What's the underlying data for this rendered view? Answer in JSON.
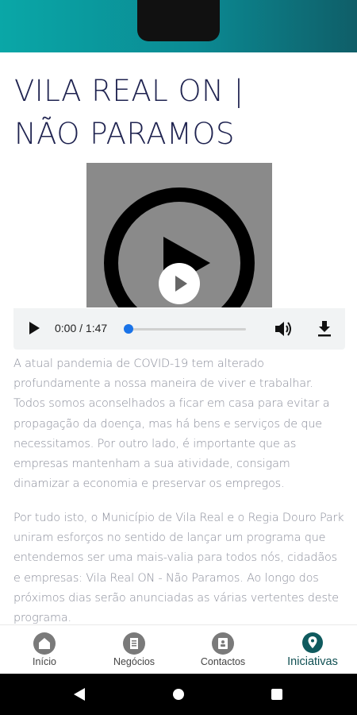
{
  "page": {
    "title_line1": "VILA REAL ON |",
    "title_line2": "NÃO PARAMOS"
  },
  "audio": {
    "current_time": "0:00",
    "duration": "1:47",
    "time_display": "0:00 / 1:47",
    "progress": 0.0,
    "accent_color": "#1a73e8"
  },
  "article": {
    "paragraphs": [
      "A atual pandemia de COVID-19 tem alterado profundamente a nossa maneira de viver e trabalhar. Todos somos aconselhados a ficar em casa para evitar a propagação da doença, mas há bens e serviços de que necessitamos. Por outro lado, é importante que as empresas mantenham a sua atividade, consigam dinamizar a economia e preservar os empregos.",
      "Por tudo isto, o Município de Vila Real e o Regia Douro Park uniram esforços no sentido de lançar um programa que entendemos ser uma mais-valia para todos nós, cidadãos e empresas: Vila Real ON - Não Paramos. Ao longo dos próximos dias serão anunciadas as várias vertentes deste programa."
    ]
  },
  "bottom_nav": {
    "items": [
      {
        "label": "Início",
        "icon": "home-icon"
      },
      {
        "label": "Negócios",
        "icon": "business-icon"
      },
      {
        "label": "Contactos",
        "icon": "contacts-icon"
      },
      {
        "label": "Iniciativas",
        "icon": "location-pin-icon",
        "active": true
      }
    ]
  },
  "colors": {
    "status_bar_gradient": [
      "#0aa7a7",
      "#0f5e68"
    ],
    "title": "#1f2350",
    "body_text": "#8a8d9a",
    "nav_active": "#0f5a5e"
  }
}
